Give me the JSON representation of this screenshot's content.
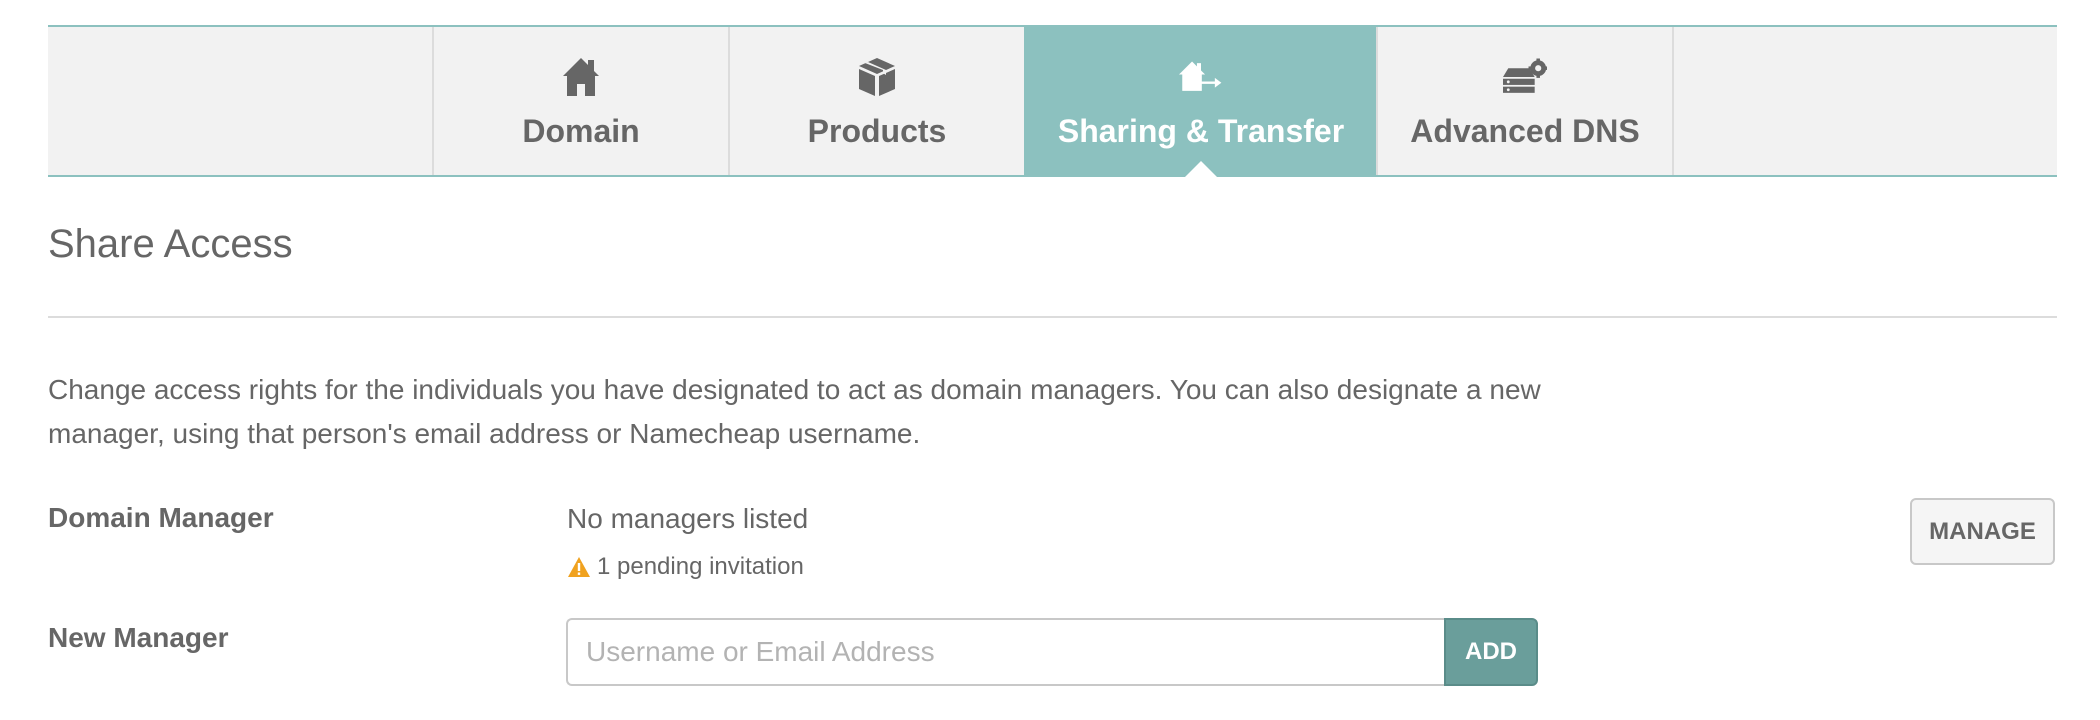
{
  "tabs": [
    {
      "label": "Domain",
      "icon": "house-icon",
      "active": false
    },
    {
      "label": "Products",
      "icon": "box-icon",
      "active": false
    },
    {
      "label": "Sharing & Transfer",
      "icon": "house-transfer-icon",
      "active": true
    },
    {
      "label": "Advanced DNS",
      "icon": "server-gear-icon",
      "active": false
    }
  ],
  "section": {
    "title": "Share Access",
    "description": "Change access rights for the individuals you have designated to act as domain managers. You can also designate a new manager, using that person's email address or Namecheap username."
  },
  "domain_manager": {
    "label": "Domain Manager",
    "value": "No managers listed",
    "pending_text": "1 pending invitation",
    "manage_label": "MANAGE"
  },
  "new_manager": {
    "label": "New Manager",
    "input_value": "",
    "placeholder": "Username or Email Address",
    "add_label": "ADD"
  },
  "colors": {
    "accent": "#8cc1bf",
    "add_button": "#6a9e9b",
    "warning": "#f0a21f",
    "text": "#666666"
  }
}
